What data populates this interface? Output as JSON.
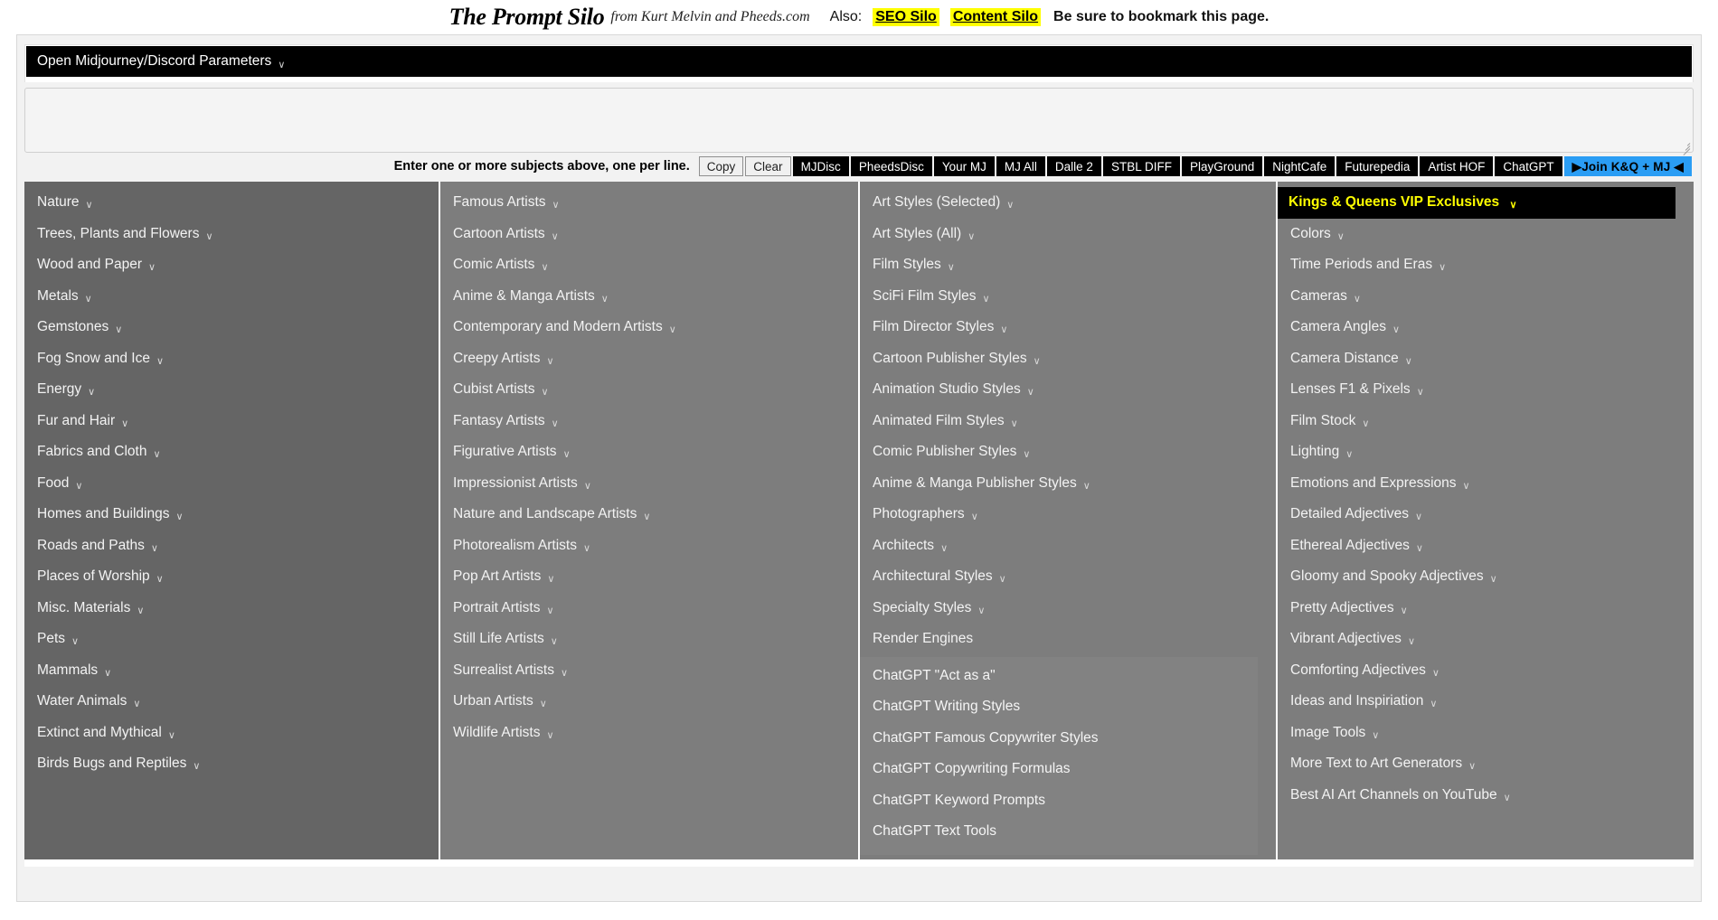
{
  "header": {
    "brand": "The Prompt Silo",
    "byline": "from Kurt Melvin and Pheeds.com",
    "also_label": "Also:",
    "links": [
      {
        "label": "SEO Silo"
      },
      {
        "label": "Content Silo"
      }
    ],
    "bookmark_note": "Be sure to bookmark this page."
  },
  "params": {
    "label": "Open Midjourney/Discord Parameters",
    "chevron": "∨"
  },
  "subject_input": {
    "value": "",
    "placeholder": ""
  },
  "actions": {
    "hint": "Enter one or more subjects above, one per line.",
    "buttons": [
      {
        "label": "Copy",
        "style": "light"
      },
      {
        "label": "Clear",
        "style": "light"
      },
      {
        "label": "MJDisc",
        "style": "dark"
      },
      {
        "label": "PheedsDisc",
        "style": "dark"
      },
      {
        "label": "Your MJ",
        "style": "dark"
      },
      {
        "label": "MJ All",
        "style": "dark"
      },
      {
        "label": "Dalle 2",
        "style": "dark"
      },
      {
        "label": "STBL DIFF",
        "style": "dark"
      },
      {
        "label": "PlayGround",
        "style": "dark"
      },
      {
        "label": "NightCafe",
        "style": "dark"
      },
      {
        "label": "Futurepedia",
        "style": "dark"
      },
      {
        "label": "Artist HOF",
        "style": "dark"
      },
      {
        "label": "ChatGPT",
        "style": "dark"
      },
      {
        "label": "▶Join K&Q + MJ ◀",
        "style": "join"
      }
    ],
    "accent_blue": "#2a9df4",
    "highlight_yellow": "#ffff00"
  },
  "columns": {
    "col1": {
      "items": [
        {
          "label": "Nature",
          "chevron": "∨"
        },
        {
          "label": "Trees, Plants and Flowers",
          "chevron": "∨"
        },
        {
          "label": "Wood and Paper",
          "chevron": "∨"
        },
        {
          "label": "Metals",
          "chevron": "∨"
        },
        {
          "label": "Gemstones",
          "chevron": "∨"
        },
        {
          "label": "Fog Snow and Ice",
          "chevron": "∨"
        },
        {
          "label": "Energy",
          "chevron": "∨"
        },
        {
          "label": "Fur and Hair",
          "chevron": "∨"
        },
        {
          "label": "Fabrics and Cloth",
          "chevron": "∨"
        },
        {
          "label": "Food",
          "chevron": "∨"
        },
        {
          "label": "Homes and Buildings",
          "chevron": "∨"
        },
        {
          "label": "Roads and Paths",
          "chevron": "∨"
        },
        {
          "label": "Places of Worship",
          "chevron": "∨"
        },
        {
          "label": "Misc. Materials",
          "chevron": "∨"
        },
        {
          "label": "Pets",
          "chevron": "∨"
        },
        {
          "label": "Mammals",
          "chevron": "∨"
        },
        {
          "label": "Water Animals",
          "chevron": "∨"
        },
        {
          "label": "Extinct and Mythical",
          "chevron": "∨"
        },
        {
          "label": "Birds Bugs and Reptiles",
          "chevron": "∨"
        }
      ]
    },
    "col2": {
      "items": [
        {
          "label": "Famous Artists",
          "chevron": "∨"
        },
        {
          "label": "Cartoon Artists",
          "chevron": "∨"
        },
        {
          "label": "Comic Artists",
          "chevron": "∨"
        },
        {
          "label": "Anime & Manga Artists",
          "chevron": "∨"
        },
        {
          "label": "Contemporary and Modern Artists",
          "chevron": "∨"
        },
        {
          "label": "Creepy Artists",
          "chevron": "∨"
        },
        {
          "label": "Cubist Artists",
          "chevron": "∨"
        },
        {
          "label": "Fantasy Artists",
          "chevron": "∨"
        },
        {
          "label": "Figurative Artists",
          "chevron": "∨"
        },
        {
          "label": "Impressionist Artists",
          "chevron": "∨"
        },
        {
          "label": "Nature and Landscape Artists",
          "chevron": "∨"
        },
        {
          "label": "Photorealism Artists",
          "chevron": "∨"
        },
        {
          "label": "Pop Art Artists",
          "chevron": "∨"
        },
        {
          "label": "Portrait Artists",
          "chevron": "∨"
        },
        {
          "label": "Still Life Artists",
          "chevron": "∨"
        },
        {
          "label": "Surrealist Artists",
          "chevron": "∨"
        },
        {
          "label": "Urban Artists",
          "chevron": "∨"
        },
        {
          "label": "Wildlife Artists",
          "chevron": "∨"
        }
      ]
    },
    "col3": {
      "items": [
        {
          "label": "Art Styles (Selected)",
          "chevron": "∨"
        },
        {
          "label": "Art Styles (All)",
          "chevron": "∨"
        },
        {
          "label": "Film Styles",
          "chevron": "∨"
        },
        {
          "label": "SciFi Film Styles",
          "chevron": "∨"
        },
        {
          "label": "Film Director Styles",
          "chevron": "∨"
        },
        {
          "label": "Cartoon Publisher Styles",
          "chevron": "∨"
        },
        {
          "label": "Animation Studio Styles",
          "chevron": "∨"
        },
        {
          "label": "Animated Film Styles",
          "chevron": "∨"
        },
        {
          "label": "Comic Publisher Styles",
          "chevron": "∨"
        },
        {
          "label": "Anime & Manga Publisher Styles",
          "chevron": "∨"
        },
        {
          "label": "Photographers",
          "chevron": "∨"
        },
        {
          "label": "Architects",
          "chevron": "∨"
        },
        {
          "label": "Architectural Styles",
          "chevron": "∨"
        },
        {
          "label": "Specialty Styles",
          "chevron": "∨"
        },
        {
          "label": "Render Engines",
          "chevron": ""
        }
      ],
      "gpt_items": [
        {
          "label": "ChatGPT \"Act as a\"",
          "chevron": ""
        },
        {
          "label": "ChatGPT Writing Styles",
          "chevron": ""
        },
        {
          "label": "ChatGPT Famous Copywriter Styles",
          "chevron": ""
        },
        {
          "label": "ChatGPT Copywriting Formulas",
          "chevron": ""
        },
        {
          "label": "ChatGPT Keyword Prompts",
          "chevron": ""
        },
        {
          "label": "ChatGPT Text Tools",
          "chevron": ""
        }
      ]
    },
    "col4": {
      "vip": {
        "label": "Kings & Queens VIP Exclusives",
        "chevron": "∨"
      },
      "items": [
        {
          "label": "Colors",
          "chevron": "∨"
        },
        {
          "label": "Time Periods and Eras",
          "chevron": "∨"
        },
        {
          "label": "Cameras",
          "chevron": "∨"
        },
        {
          "label": "Camera Angles",
          "chevron": "∨"
        },
        {
          "label": "Camera Distance",
          "chevron": "∨"
        },
        {
          "label": "Lenses F1 & Pixels",
          "chevron": "∨"
        },
        {
          "label": "Film Stock",
          "chevron": "∨"
        },
        {
          "label": "Lighting",
          "chevron": "∨"
        },
        {
          "label": "Emotions and Expressions",
          "chevron": "∨"
        },
        {
          "label": "Detailed Adjectives",
          "chevron": "∨"
        },
        {
          "label": "Ethereal Adjectives",
          "chevron": "∨"
        },
        {
          "label": "Gloomy and Spooky Adjectives",
          "chevron": "∨"
        },
        {
          "label": "Pretty Adjectives",
          "chevron": "∨"
        },
        {
          "label": "Vibrant Adjectives",
          "chevron": "∨"
        },
        {
          "label": "Comforting Adjectives",
          "chevron": "∨"
        },
        {
          "label": "Ideas and Inspiriation",
          "chevron": "∨"
        },
        {
          "label": "Image Tools",
          "chevron": "∨"
        },
        {
          "label": "More Text to Art Generators",
          "chevron": "∨"
        },
        {
          "label": "Best AI Art Channels on YouTube",
          "chevron": "∨"
        }
      ]
    }
  }
}
